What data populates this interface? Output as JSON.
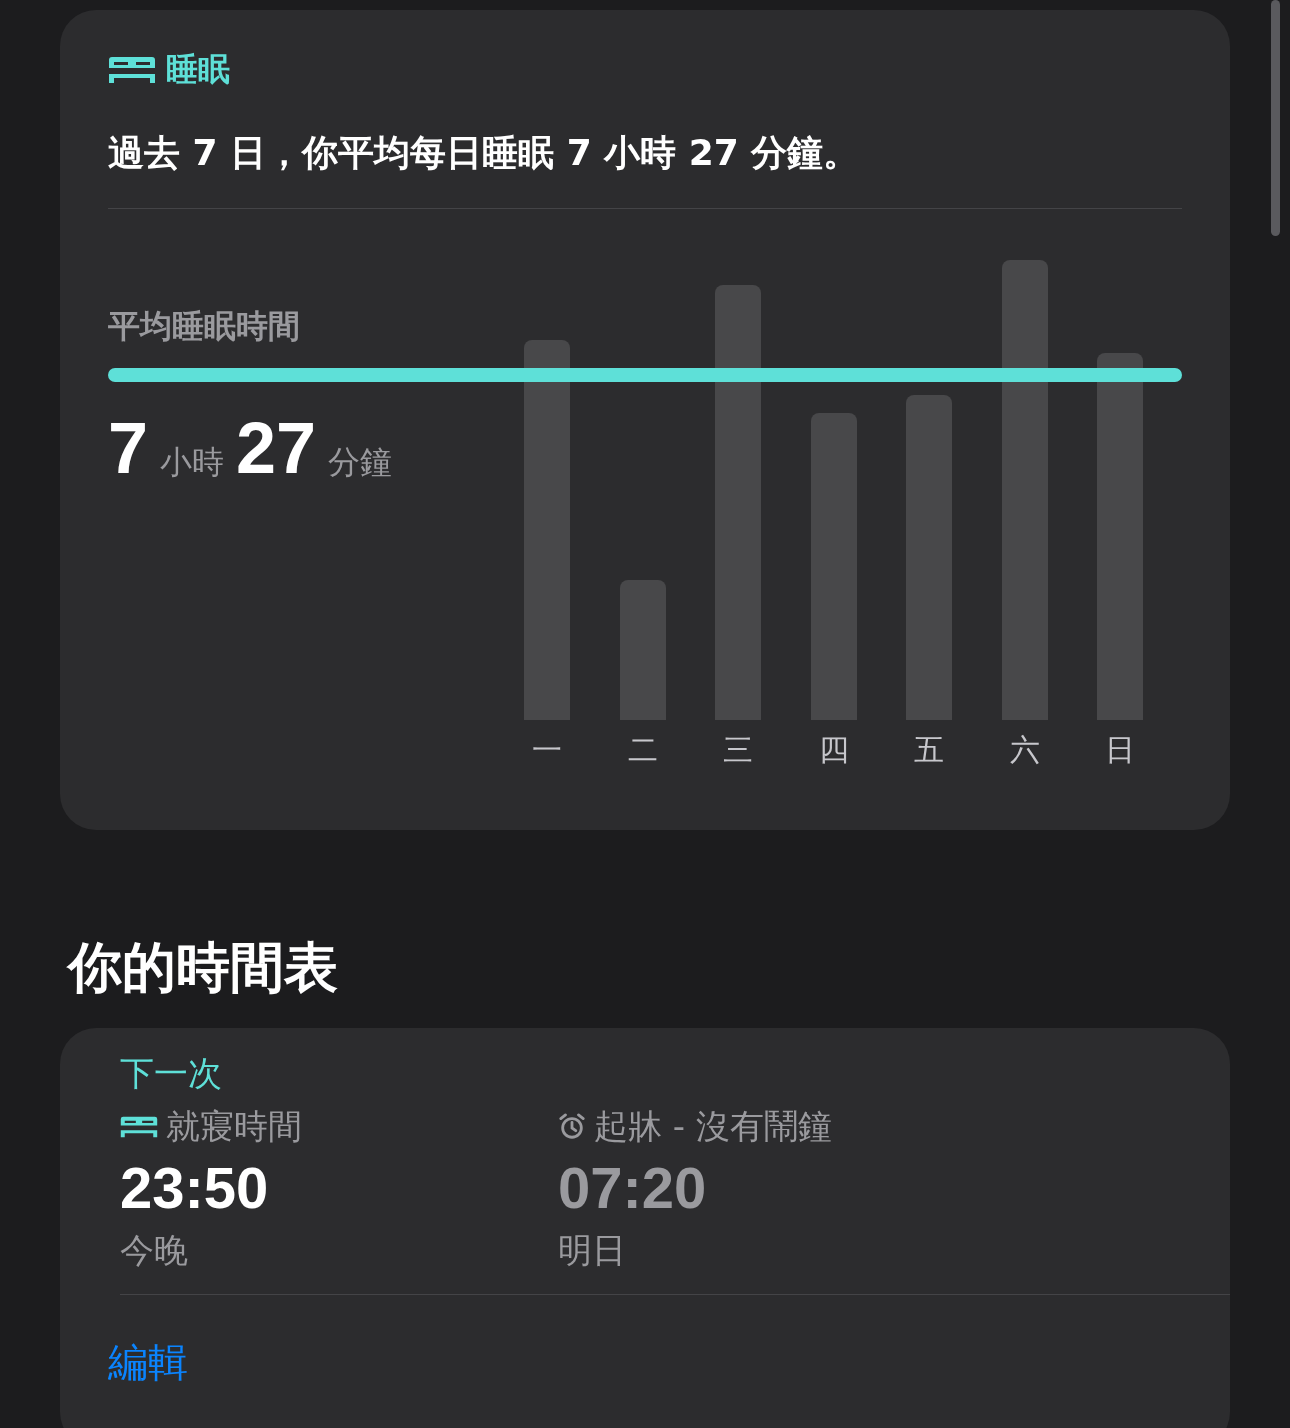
{
  "sleep_card": {
    "title": "睡眠",
    "summary": "過去 7 日，你平均每日睡眠 7 小時 27 分鐘。",
    "average": {
      "label": "平均睡眠時間",
      "hours": "7",
      "hours_unit": "小時",
      "minutes": "27",
      "minutes_unit": "分鐘"
    },
    "days": [
      "一",
      "二",
      "三",
      "四",
      "五",
      "六",
      "日"
    ]
  },
  "schedule": {
    "heading": "你的時間表",
    "next_label": "下一次",
    "items": [
      {
        "kind": "bedtime",
        "label": "就寢時間",
        "time": "23:50",
        "day": "今晚"
      },
      {
        "kind": "wake",
        "label": "起牀 - 沒有鬧鐘",
        "time": "07:20",
        "day": "明日"
      }
    ],
    "edit": "編輯"
  }
}
